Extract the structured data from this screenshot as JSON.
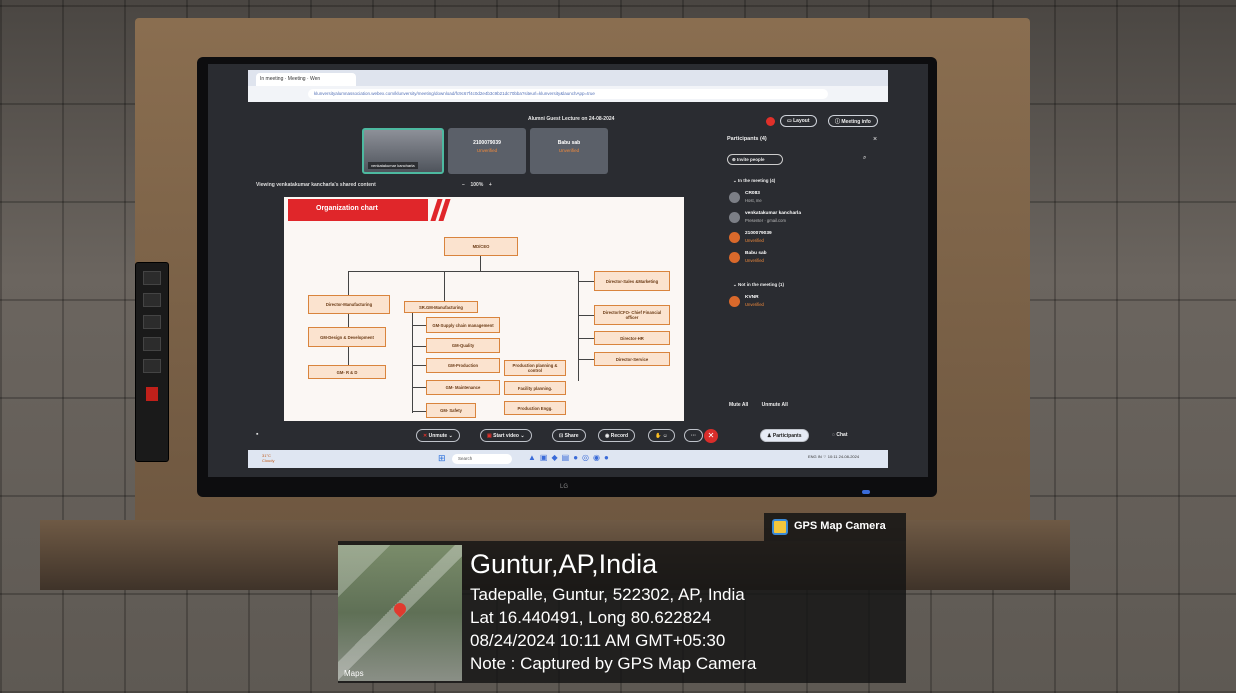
{
  "browser": {
    "tab_title": "In meeting · Meeting · Wen",
    "url": "klunversityalumnassociation.webex.com/klunversity/meeting/download/fc9c67f4c0d2e4b3c9b21dc70bba?siteurl=klunversity&launchApp=true"
  },
  "meeting": {
    "title": "Alumni Guest Lecture on 24-08-2024",
    "layout_label": "Layout",
    "info_label": "Meeting info",
    "tiles": [
      {
        "name": "venkatakumar kancharla",
        "status": ""
      },
      {
        "name": "2100079039",
        "status": "Unverified"
      },
      {
        "name": "Babu sab",
        "status": "Unverified"
      }
    ],
    "viewing_text": "Viewing venkatakumar kancharla's shared content",
    "zoom_minus": "−",
    "zoom_value": "100%",
    "zoom_plus": "+"
  },
  "slide": {
    "title": "Organization chart",
    "nodes": {
      "md": "MD/CEO",
      "dir_sales": "Director-Sales &Marketing",
      "dir_mfg": "Director-Manufacturing",
      "sr_gm": "SR.GM-Manufacturing",
      "gm_supply": "GM-Supply chain management",
      "gm_design": "GM-Design & Development",
      "gm_quality": "GM-Quality",
      "gm_prod": "GM-Production",
      "prod_plan": "Production planning & control",
      "gm_rd": "GM- R & D",
      "gm_maint": "GM- Maintenance",
      "facility": "Facility planning.",
      "gm_safety": "GM- Safety",
      "prod_engg": "Production Engg.",
      "dir_cfo": "Director/CFO- Chief Financial officer",
      "dir_hr": "Director-HR",
      "dir_service": "Director-Service"
    }
  },
  "participants": {
    "header": "Participants (4)",
    "invite_label": "Invite people",
    "in_meeting_header": "In the meeting (4)",
    "not_in_meeting_header": "Not in the meeting (1)",
    "in_meeting": [
      {
        "initial": "C",
        "name": "CR083",
        "sub": "Host, me"
      },
      {
        "initial": "v",
        "name": "venkatakumar kancharla",
        "sub": "Presenter · gmail.com"
      },
      {
        "initial": "2",
        "name": "2100079039",
        "sub": "Unverified"
      },
      {
        "initial": "B",
        "name": "Babu sab",
        "sub": "Unverified"
      }
    ],
    "not_in_meeting": [
      {
        "initial": "K",
        "name": "KVNR",
        "sub": "Unverified"
      }
    ],
    "mute_all_label": "Mute All",
    "unmute_all_label": "Unmute All"
  },
  "toolbar": {
    "unmute_label": "Unmute",
    "start_video_label": "Start video",
    "share_label": "Share",
    "record_label": "Record",
    "more_label": "···",
    "participants_label": "Participants",
    "chat_label": "Chat"
  },
  "taskbar": {
    "weather_temp": "31°C",
    "weather_desc": "Cloudy",
    "search_placeholder": "Search",
    "language": "ENG IN",
    "time": "10:11",
    "date": "24-08-2024"
  },
  "tv": {
    "brand": "LG"
  },
  "gps": {
    "badge_label": "GPS Map Camera",
    "city": "Guntur,AP,India",
    "address": "Tadepalle, Guntur, 522302, AP, India",
    "coords": "Lat 16.440491, Long 80.622824",
    "datetime": "08/24/2024 10:11 AM GMT+05:30",
    "note": "Note : Captured by GPS Map Camera",
    "maps_label": "Maps"
  },
  "colors": {
    "slide_red": "#e0262a",
    "node_fill": "#fbe3cf",
    "unverified_orange": "#f28a3c",
    "hangup_red": "#d92d2a"
  }
}
